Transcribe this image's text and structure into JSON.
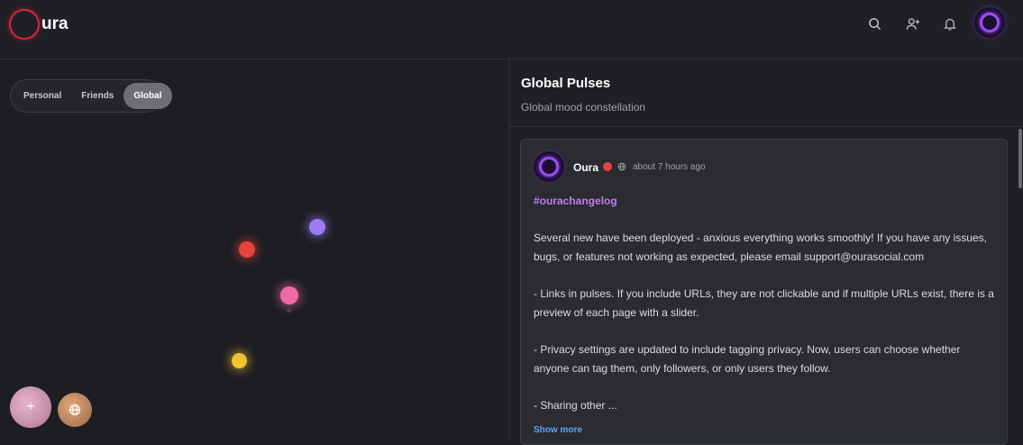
{
  "header": {
    "logo_text": "ura",
    "icons": [
      "search-icon",
      "add-user-icon",
      "bell-icon"
    ]
  },
  "view_toggle": {
    "options": [
      "Personal",
      "Friends",
      "Global"
    ],
    "selected": "Global"
  },
  "constellation": {
    "dot_colors": [
      "#9a7cf5",
      "#e8423c",
      "#f06aa8",
      "#f2c230"
    ]
  },
  "fab": {
    "plus_label": "+"
  },
  "panel": {
    "title": "Global Pulses",
    "subtitle": "Global mood constellation"
  },
  "post": {
    "author": "Oura",
    "mood_color": "#e8423c",
    "time": "about 7 hours ago",
    "hashtag": "#ourachangelog",
    "paragraphs": [
      "Several new have been deployed - anxious everything works smoothly!  If you have any issues, bugs, or features not working as expected, please email support@ourasocial.com",
      "- Links in pulses.  If you include URLs, they are not clickable and if multiple URLs exist, there is a preview of each page with a slider.",
      "- Privacy settings are updated to include tagging privacy.  Now, users can choose whether anyone can tag them, only followers, or only users they follow.",
      "- Sharing other ..."
    ],
    "show_more": "Show more"
  },
  "colors": {
    "background": "#1c1e22",
    "accent_purple": "#9b4dff",
    "logo_red": "#d7263d",
    "link_blue": "#5aa6f0",
    "hashtag_purple": "#c27cf0"
  }
}
